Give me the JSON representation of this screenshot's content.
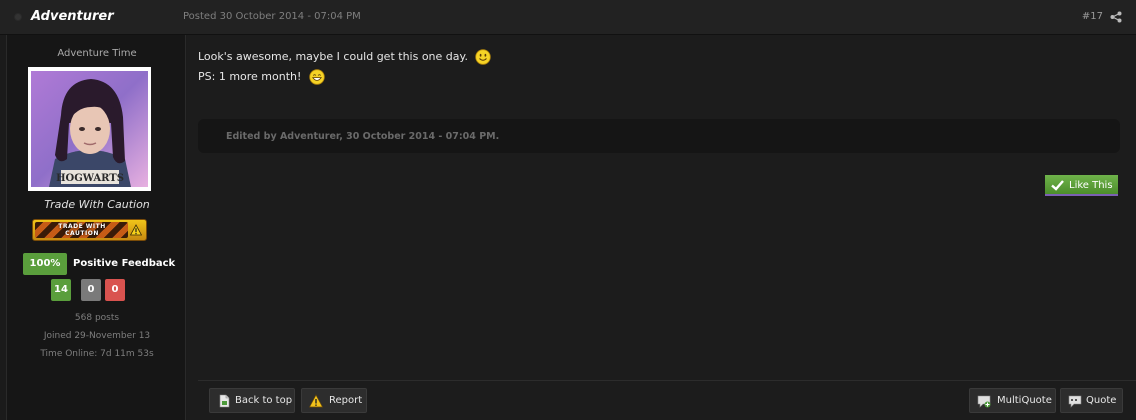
{
  "header": {
    "author": "Adventurer",
    "posted": "Posted 30 October 2014 - 07:04 PM",
    "post_number": "#17"
  },
  "author_panel": {
    "member_title": "Adventure Time",
    "avatar_caption": "HOGWARTS",
    "group_name": "Trade With Caution",
    "group_badge_text": "TRADE WITH CAUTION",
    "feedback_percent": "100%",
    "feedback_label": "Positive Feedback",
    "feedback_positive": "14",
    "feedback_neutral": "0",
    "feedback_negative": "0",
    "posts": "568 posts",
    "joined": "Joined 29-November 13",
    "time_online": "Time Online: 7d 11m 53s"
  },
  "post": {
    "line1": "Look's awesome, maybe I could get this one day.",
    "line2": "PS: 1 more month!",
    "edited": "Edited by Adventurer, 30 October 2014 - 07:04 PM.",
    "like_label": "Like This"
  },
  "footer": {
    "back_to_top": "Back to top",
    "report": "Report",
    "multiquote": "MultiQuote",
    "quote": "Quote"
  },
  "colors": {
    "accent_green": "#5a9e3c",
    "negative_red": "#d9534f",
    "background": "#1b1b1b"
  }
}
